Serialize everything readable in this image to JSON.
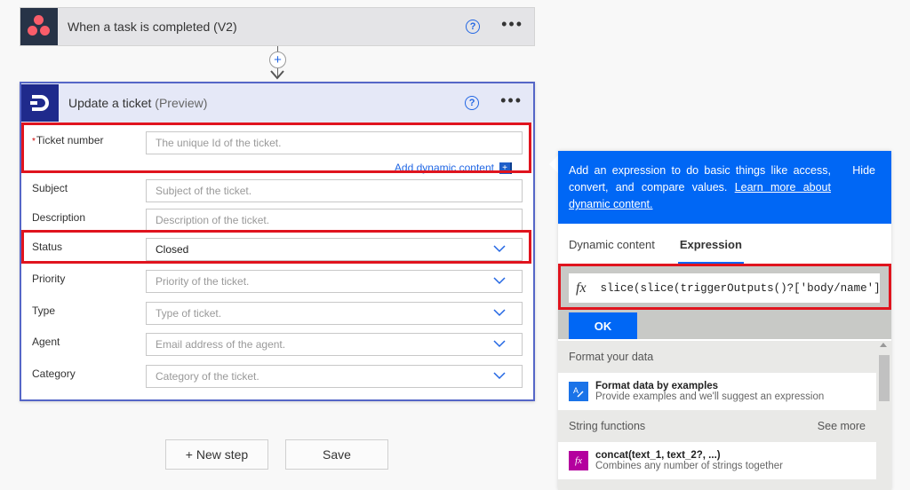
{
  "trigger": {
    "title": "When a task is completed (V2)",
    "help_icon": "?",
    "more_icon": "•••"
  },
  "connector": {
    "add_icon": "+"
  },
  "action": {
    "title": "Update a ticket",
    "subtitle": "(Preview)",
    "help_icon": "?",
    "more_icon": "•••",
    "fields": [
      {
        "label": "Ticket number",
        "required": true,
        "placeholder": "The unique Id of the ticket.",
        "value": "",
        "dropdown": false
      },
      {
        "label": "Subject",
        "required": false,
        "placeholder": "Subject of the ticket.",
        "value": "",
        "dropdown": false
      },
      {
        "label": "Description",
        "required": false,
        "placeholder": "Description of the ticket.",
        "value": "",
        "dropdown": false
      },
      {
        "label": "Status",
        "required": false,
        "placeholder": "",
        "value": "Closed",
        "dropdown": true
      },
      {
        "label": "Priority",
        "required": false,
        "placeholder": "Priority of the ticket.",
        "value": "",
        "dropdown": true
      },
      {
        "label": "Type",
        "required": false,
        "placeholder": "Type of ticket.",
        "value": "",
        "dropdown": true
      },
      {
        "label": "Agent",
        "required": false,
        "placeholder": "Email address of the agent.",
        "value": "",
        "dropdown": true
      },
      {
        "label": "Category",
        "required": false,
        "placeholder": "Category of the ticket.",
        "value": "",
        "dropdown": true
      }
    ],
    "required_mark": "*",
    "add_dynamic_content": "Add dynamic content",
    "add_dynamic_icon": "+"
  },
  "buttons": {
    "new_step": "+ New step",
    "save": "Save"
  },
  "panel": {
    "info_text": "Add an expression to do basic things like access, convert, and compare values.",
    "learn_more": "Learn more about dynamic content.",
    "hide": "Hide",
    "tabs": [
      {
        "label": "Dynamic content",
        "active": false
      },
      {
        "label": "Expression",
        "active": true
      }
    ],
    "fx_label": "fx",
    "expression": "slice(slice(triggerOutputs()?['body/name']",
    "ok": "OK",
    "sections": [
      {
        "title": "Format your data",
        "see_more": "",
        "items": [
          {
            "icon": "format-data-icon",
            "icon_color": "#1a73e8",
            "name": "Format data by examples",
            "desc": "Provide examples and we'll suggest an expression"
          }
        ]
      },
      {
        "title": "String functions",
        "see_more": "See more",
        "items": [
          {
            "icon": "function-icon",
            "icon_color": "#b4009e",
            "name": "concat(text_1, text_2?, ...)",
            "desc": "Combines any number of strings together"
          }
        ]
      }
    ]
  },
  "colors": {
    "accent": "#0067f5",
    "highlight": "#e0141e",
    "action_border": "#5566c7",
    "trigger_icon_bg": "#273347",
    "action_icon_bg": "#1f2a8c"
  }
}
